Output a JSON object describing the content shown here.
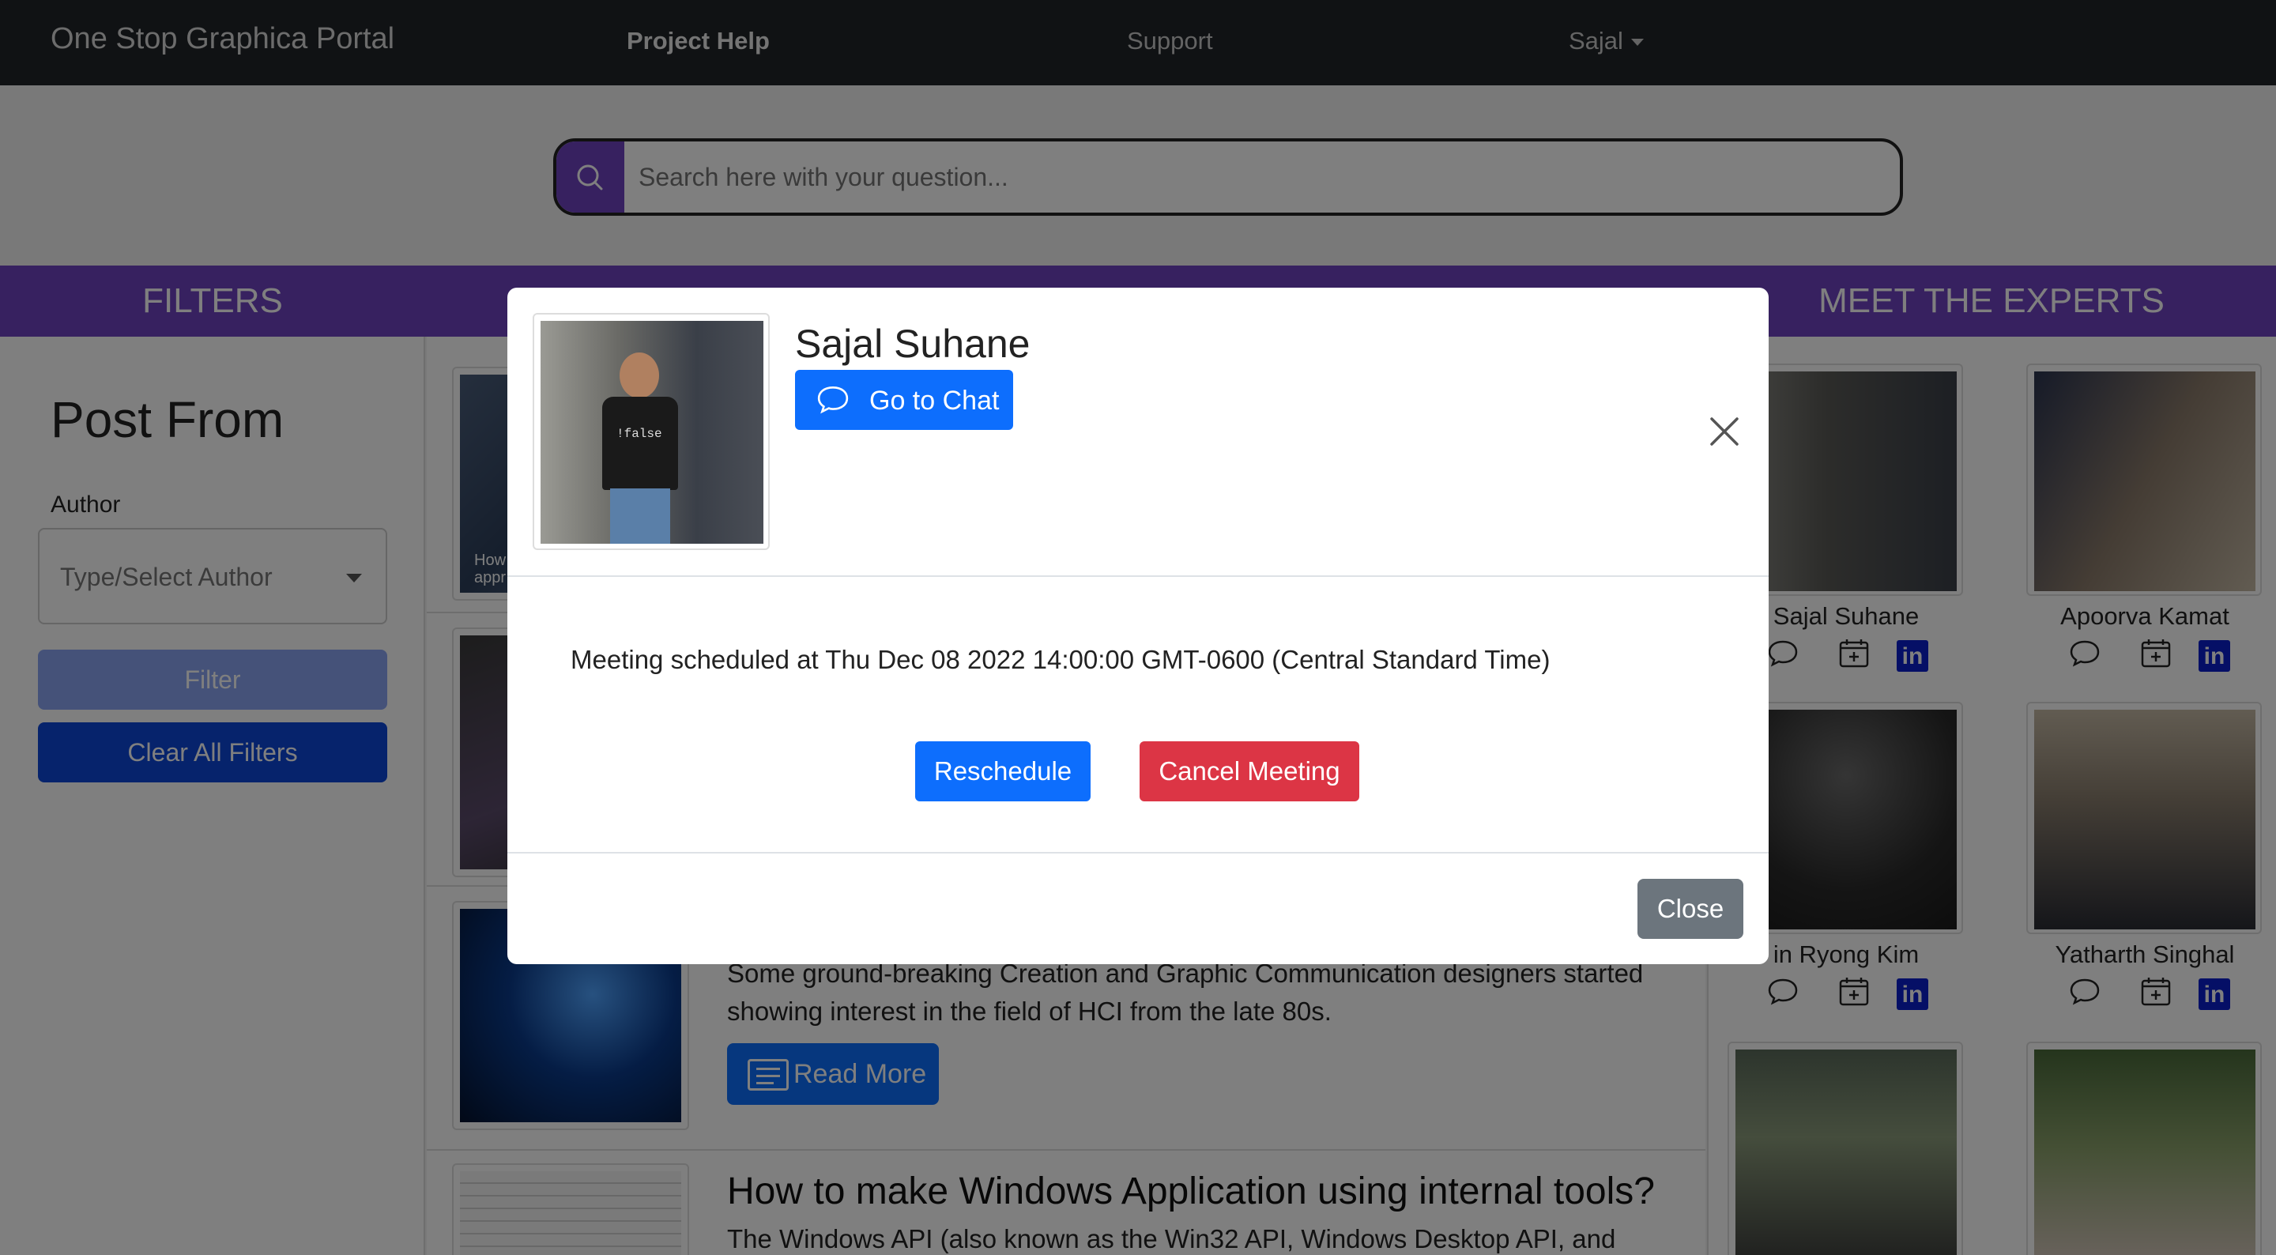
{
  "navbar": {
    "brand": "One Stop Graphica Portal",
    "links": [
      {
        "label": "Project Help"
      },
      {
        "label": "Support"
      },
      {
        "label": "Sajal"
      }
    ]
  },
  "search": {
    "placeholder": "Search here with your question...",
    "icon": "search-icon"
  },
  "filters": {
    "header": "FILTERS",
    "title": "Post From",
    "author_label": "Author",
    "author_placeholder": "Type/Select Author",
    "filter_button": "Filter",
    "clear_button": "Clear All Filters"
  },
  "feed": {
    "posts": [
      {
        "excerpt_partial": "How t\nappr"
      },
      {},
      {
        "excerpt": [
          "Some ground-breaking Creation and Graphic Communication designers started",
          "showing interest in the field of HCI from the late 80s."
        ],
        "read_more": "Read More"
      },
      {
        "title": "How to make Windows Application using internal tools?",
        "excerpt": "The Windows API (also known as the Win32 API, Windows Desktop API, and"
      }
    ]
  },
  "experts": {
    "header": "MEET THE EXPERTS",
    "list": [
      {
        "name": "Sajal Suhane"
      },
      {
        "name": "Apoorva Kamat"
      },
      {
        "name": "in Ryong Kim"
      },
      {
        "name": "Yatharth Singhal"
      },
      {
        "name": ""
      },
      {
        "name": ""
      }
    ],
    "linkedin_glyph": "in"
  },
  "modal": {
    "name": "Sajal Suhane",
    "chat_button": "Go to Chat",
    "meeting_text": "Meeting scheduled at Thu Dec 08 2022 14:00:00 GMT-0600 (Central Standard Time)",
    "reschedule_button": "Reschedule",
    "cancel_button": "Cancel Meeting",
    "close_button": "Close",
    "shirt_text": "!false"
  },
  "colors": {
    "brand_purple": "#6f42c1",
    "primary": "#0d6efd",
    "danger": "#dc3545",
    "secondary": "#6c757d",
    "navbar": "#212529"
  }
}
